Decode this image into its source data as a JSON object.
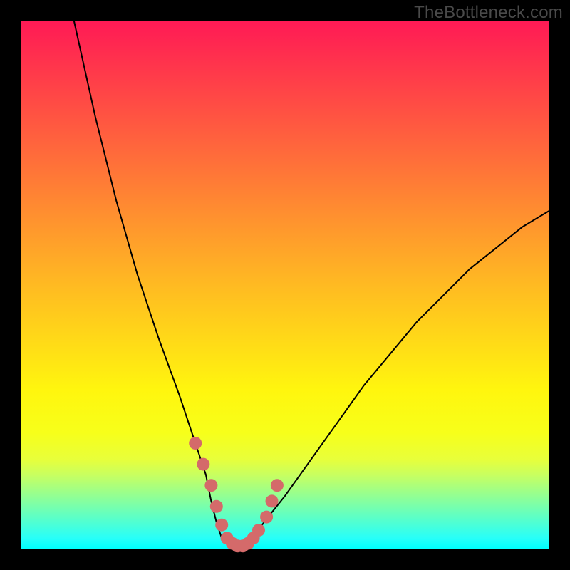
{
  "watermark": "TheBottleneck.com",
  "chart_data": {
    "type": "line",
    "title": "",
    "xlabel": "",
    "ylabel": "",
    "xlim": [
      0,
      100
    ],
    "ylim": [
      0,
      100
    ],
    "grid": false,
    "legend": false,
    "background_gradient": {
      "orientation": "vertical",
      "stops": [
        {
          "pos": 0,
          "color": "#ff1a55"
        },
        {
          "pos": 50,
          "color": "#ffba22"
        },
        {
          "pos": 80,
          "color": "#f0ff20"
        },
        {
          "pos": 100,
          "color": "#00ffff"
        }
      ]
    },
    "series": [
      {
        "name": "main-curve",
        "color": "#000000",
        "stroke_width": 2,
        "x": [
          10,
          14,
          18,
          22,
          26,
          30,
          33,
          35,
          36,
          37,
          38,
          40,
          42,
          44,
          46,
          50,
          55,
          60,
          65,
          70,
          75,
          80,
          85,
          90,
          95,
          100
        ],
        "values": [
          100,
          82,
          66,
          52,
          40,
          29,
          20,
          14,
          9,
          5,
          2,
          0,
          0,
          2,
          5,
          10,
          17,
          24,
          31,
          37,
          43,
          48,
          53,
          57,
          61,
          64
        ]
      },
      {
        "name": "highlight-dots",
        "color": "#d46a6a",
        "marker": "circle",
        "marker_size": 9,
        "x": [
          33.0,
          34.5,
          36.0,
          37.0,
          38.0,
          39.0,
          40.0,
          41.0,
          42.0,
          43.0,
          44.0,
          45.0,
          46.5,
          47.5,
          48.5
        ],
        "values": [
          20.0,
          16.0,
          12.0,
          8.0,
          4.5,
          2.0,
          1.0,
          0.5,
          0.5,
          1.0,
          2.0,
          3.5,
          6.0,
          9.0,
          12.0
        ]
      }
    ]
  },
  "colors": {
    "frame": "#000000",
    "watermark": "#4a4a4a",
    "curve": "#000000",
    "highlight": "#d46a6a"
  }
}
